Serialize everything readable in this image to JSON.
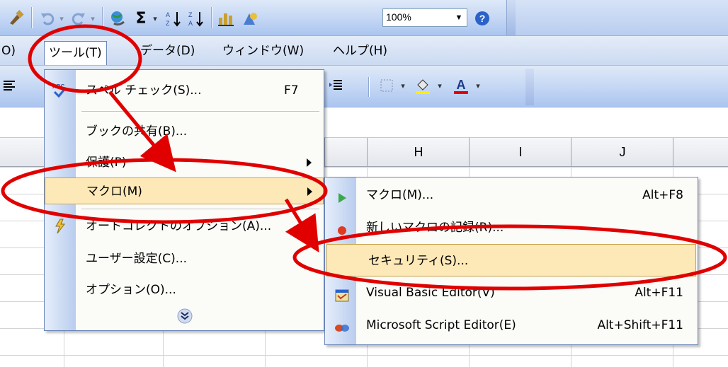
{
  "toolbar": {
    "zoom_value": "100%"
  },
  "menubar": {
    "items": [
      "ツール(T)",
      "データ(D)",
      "ウィンドウ(W)",
      "ヘルプ(H)"
    ]
  },
  "columns": [
    "H",
    "I",
    "J"
  ],
  "tools_menu": {
    "items": [
      {
        "label": "スペル チェック(S)...",
        "shortcut": "F7"
      },
      {
        "label": "ブックの共有(B)..."
      },
      {
        "label": "保護(P)"
      },
      {
        "label": "マクロ(M)"
      },
      {
        "label": "オートコレクトのオプション(A)..."
      },
      {
        "label": "ユーザー設定(C)..."
      },
      {
        "label": "オプション(O)..."
      }
    ]
  },
  "macro_menu": {
    "items": [
      {
        "label": "マクロ(M)...",
        "shortcut": "Alt+F8"
      },
      {
        "label": "新しいマクロの記録(R)..."
      },
      {
        "label": "セキュリティ(S)..."
      },
      {
        "label": "Visual Basic Editor(V)",
        "shortcut": "Alt+F11"
      },
      {
        "label": "Microsoft Script Editor(E)",
        "shortcut": "Alt+Shift+F11"
      }
    ]
  },
  "colors": {
    "highlight": "#fde9b8",
    "annotation": "#e00000",
    "toolbar": "#c3d6f4"
  }
}
